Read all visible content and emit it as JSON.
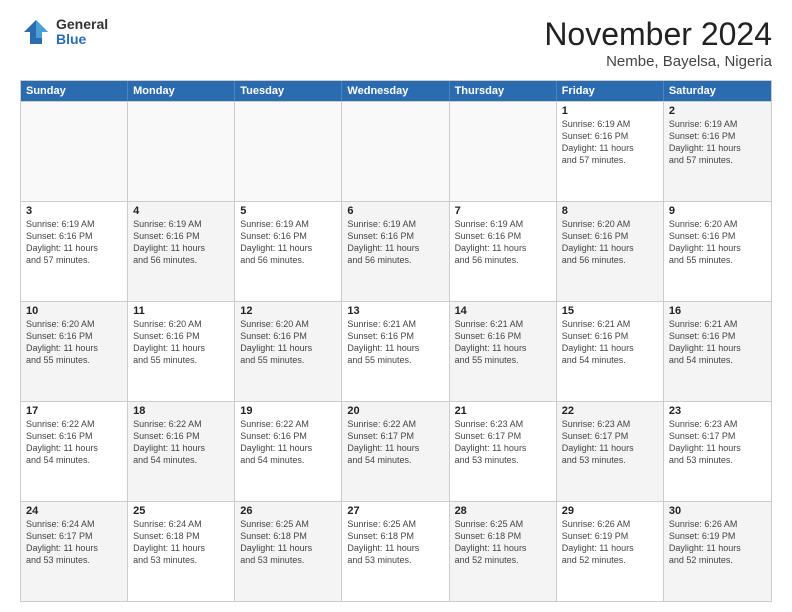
{
  "logo": {
    "general": "General",
    "blue": "Blue"
  },
  "title": "November 2024",
  "location": "Nembe, Bayelsa, Nigeria",
  "headers": [
    "Sunday",
    "Monday",
    "Tuesday",
    "Wednesday",
    "Thursday",
    "Friday",
    "Saturday"
  ],
  "rows": [
    [
      {
        "day": "",
        "info": "",
        "empty": true
      },
      {
        "day": "",
        "info": "",
        "empty": true
      },
      {
        "day": "",
        "info": "",
        "empty": true
      },
      {
        "day": "",
        "info": "",
        "empty": true
      },
      {
        "day": "",
        "info": "",
        "empty": true
      },
      {
        "day": "1",
        "info": "Sunrise: 6:19 AM\nSunset: 6:16 PM\nDaylight: 11 hours\nand 57 minutes.",
        "empty": false,
        "alt": false
      },
      {
        "day": "2",
        "info": "Sunrise: 6:19 AM\nSunset: 6:16 PM\nDaylight: 11 hours\nand 57 minutes.",
        "empty": false,
        "alt": true
      }
    ],
    [
      {
        "day": "3",
        "info": "Sunrise: 6:19 AM\nSunset: 6:16 PM\nDaylight: 11 hours\nand 57 minutes.",
        "empty": false,
        "alt": false
      },
      {
        "day": "4",
        "info": "Sunrise: 6:19 AM\nSunset: 6:16 PM\nDaylight: 11 hours\nand 56 minutes.",
        "empty": false,
        "alt": true
      },
      {
        "day": "5",
        "info": "Sunrise: 6:19 AM\nSunset: 6:16 PM\nDaylight: 11 hours\nand 56 minutes.",
        "empty": false,
        "alt": false
      },
      {
        "day": "6",
        "info": "Sunrise: 6:19 AM\nSunset: 6:16 PM\nDaylight: 11 hours\nand 56 minutes.",
        "empty": false,
        "alt": true
      },
      {
        "day": "7",
        "info": "Sunrise: 6:19 AM\nSunset: 6:16 PM\nDaylight: 11 hours\nand 56 minutes.",
        "empty": false,
        "alt": false
      },
      {
        "day": "8",
        "info": "Sunrise: 6:20 AM\nSunset: 6:16 PM\nDaylight: 11 hours\nand 56 minutes.",
        "empty": false,
        "alt": true
      },
      {
        "day": "9",
        "info": "Sunrise: 6:20 AM\nSunset: 6:16 PM\nDaylight: 11 hours\nand 55 minutes.",
        "empty": false,
        "alt": false
      }
    ],
    [
      {
        "day": "10",
        "info": "Sunrise: 6:20 AM\nSunset: 6:16 PM\nDaylight: 11 hours\nand 55 minutes.",
        "empty": false,
        "alt": true
      },
      {
        "day": "11",
        "info": "Sunrise: 6:20 AM\nSunset: 6:16 PM\nDaylight: 11 hours\nand 55 minutes.",
        "empty": false,
        "alt": false
      },
      {
        "day": "12",
        "info": "Sunrise: 6:20 AM\nSunset: 6:16 PM\nDaylight: 11 hours\nand 55 minutes.",
        "empty": false,
        "alt": true
      },
      {
        "day": "13",
        "info": "Sunrise: 6:21 AM\nSunset: 6:16 PM\nDaylight: 11 hours\nand 55 minutes.",
        "empty": false,
        "alt": false
      },
      {
        "day": "14",
        "info": "Sunrise: 6:21 AM\nSunset: 6:16 PM\nDaylight: 11 hours\nand 55 minutes.",
        "empty": false,
        "alt": true
      },
      {
        "day": "15",
        "info": "Sunrise: 6:21 AM\nSunset: 6:16 PM\nDaylight: 11 hours\nand 54 minutes.",
        "empty": false,
        "alt": false
      },
      {
        "day": "16",
        "info": "Sunrise: 6:21 AM\nSunset: 6:16 PM\nDaylight: 11 hours\nand 54 minutes.",
        "empty": false,
        "alt": true
      }
    ],
    [
      {
        "day": "17",
        "info": "Sunrise: 6:22 AM\nSunset: 6:16 PM\nDaylight: 11 hours\nand 54 minutes.",
        "empty": false,
        "alt": false
      },
      {
        "day": "18",
        "info": "Sunrise: 6:22 AM\nSunset: 6:16 PM\nDaylight: 11 hours\nand 54 minutes.",
        "empty": false,
        "alt": true
      },
      {
        "day": "19",
        "info": "Sunrise: 6:22 AM\nSunset: 6:16 PM\nDaylight: 11 hours\nand 54 minutes.",
        "empty": false,
        "alt": false
      },
      {
        "day": "20",
        "info": "Sunrise: 6:22 AM\nSunset: 6:17 PM\nDaylight: 11 hours\nand 54 minutes.",
        "empty": false,
        "alt": true
      },
      {
        "day": "21",
        "info": "Sunrise: 6:23 AM\nSunset: 6:17 PM\nDaylight: 11 hours\nand 53 minutes.",
        "empty": false,
        "alt": false
      },
      {
        "day": "22",
        "info": "Sunrise: 6:23 AM\nSunset: 6:17 PM\nDaylight: 11 hours\nand 53 minutes.",
        "empty": false,
        "alt": true
      },
      {
        "day": "23",
        "info": "Sunrise: 6:23 AM\nSunset: 6:17 PM\nDaylight: 11 hours\nand 53 minutes.",
        "empty": false,
        "alt": false
      }
    ],
    [
      {
        "day": "24",
        "info": "Sunrise: 6:24 AM\nSunset: 6:17 PM\nDaylight: 11 hours\nand 53 minutes.",
        "empty": false,
        "alt": true
      },
      {
        "day": "25",
        "info": "Sunrise: 6:24 AM\nSunset: 6:18 PM\nDaylight: 11 hours\nand 53 minutes.",
        "empty": false,
        "alt": false
      },
      {
        "day": "26",
        "info": "Sunrise: 6:25 AM\nSunset: 6:18 PM\nDaylight: 11 hours\nand 53 minutes.",
        "empty": false,
        "alt": true
      },
      {
        "day": "27",
        "info": "Sunrise: 6:25 AM\nSunset: 6:18 PM\nDaylight: 11 hours\nand 53 minutes.",
        "empty": false,
        "alt": false
      },
      {
        "day": "28",
        "info": "Sunrise: 6:25 AM\nSunset: 6:18 PM\nDaylight: 11 hours\nand 52 minutes.",
        "empty": false,
        "alt": true
      },
      {
        "day": "29",
        "info": "Sunrise: 6:26 AM\nSunset: 6:19 PM\nDaylight: 11 hours\nand 52 minutes.",
        "empty": false,
        "alt": false
      },
      {
        "day": "30",
        "info": "Sunrise: 6:26 AM\nSunset: 6:19 PM\nDaylight: 11 hours\nand 52 minutes.",
        "empty": false,
        "alt": true
      }
    ]
  ]
}
